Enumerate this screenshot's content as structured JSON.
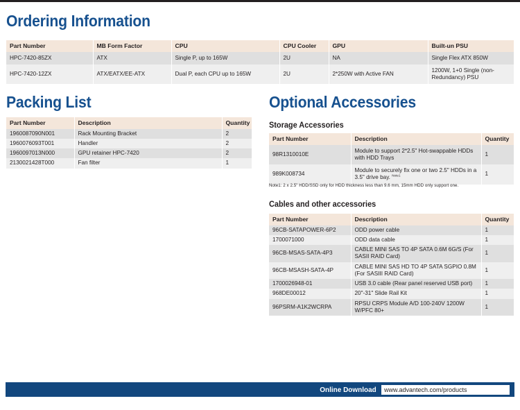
{
  "colors": {
    "heading_blue": "#17518f",
    "footer_blue": "#12477e",
    "table_header_beige": "#f4e6da",
    "row_dark": "#dfdfdf",
    "row_light": "#efefef"
  },
  "ordering": {
    "title": "Ordering Information",
    "columns": [
      "Part Number",
      "MB Form Factor",
      "CPU",
      "CPU Cooler",
      "GPU",
      "Built-un PSU"
    ],
    "rows": [
      {
        "part_number": "HPC-7420-85ZX",
        "mb_form_factor": "ATX",
        "cpu": "Single P, up to 165W",
        "cpu_cooler": "2U",
        "gpu": "NA",
        "psu": "Single Flex ATX 850W"
      },
      {
        "part_number": "HPC-7420-12ZX",
        "mb_form_factor": "ATX/EATX/EE-ATX",
        "cpu": "Dual P, each CPU up to 165W",
        "cpu_cooler": "2U",
        "gpu": "2*250W with Active FAN",
        "psu": "1200W, 1+0 Single (non-Redundancy) PSU"
      }
    ]
  },
  "packing": {
    "title": "Packing List",
    "columns": [
      "Part Number",
      "Description",
      "Quantity"
    ],
    "rows": [
      {
        "part_number": "1960087090N001",
        "description": "Rack Mounting Bracket",
        "quantity": "2"
      },
      {
        "part_number": "1960076093T001",
        "description": "Handler",
        "quantity": "2"
      },
      {
        "part_number": "1960097013N000",
        "description": "GPU retainer HPC-7420",
        "quantity": "2"
      },
      {
        "part_number": "2130021428T000",
        "description": "Fan filter",
        "quantity": "1"
      }
    ]
  },
  "optional": {
    "title": "Optional Accessories",
    "storage": {
      "subtitle": "Storage Accessories",
      "columns": [
        "Part Number",
        "Description",
        "Quantity"
      ],
      "rows": [
        {
          "part_number": "98R1310010E",
          "description": "Module to support 2*2.5\" Hot-swappable HDDs with HDD Trays",
          "note_ref": "",
          "quantity": "1"
        },
        {
          "part_number": "989K008734",
          "description": "Module to securely fix one or two 2.5\" HDDs in a 3.5\" drive bay.",
          "note_ref": "Note1",
          "quantity": "1"
        }
      ],
      "note": "Note1: 2 x 2.5\" HDD/SSD only for HDD thickness less than 9.6 mm, 15mm HDD only support one."
    },
    "cables": {
      "subtitle": "Cables and other accessories",
      "columns": [
        "Part Number",
        "Description",
        "Quantity"
      ],
      "rows": [
        {
          "part_number": "96CB-SATAPOWER-6P2",
          "description": "ODD power cable",
          "quantity": "1"
        },
        {
          "part_number": "1700071000",
          "description": "ODD data cable",
          "quantity": "1"
        },
        {
          "part_number": "96CB-MSAS-SATA-4P3",
          "description": "CABLE MINI SAS TO 4P SATA 0.6M 6G/S (For SASII RAID Card)",
          "quantity": "1"
        },
        {
          "part_number": "96CB-MSASH-SATA-4P",
          "description": "CABLE MINI SAS HD TO 4P SATA SGPIO 0.8M (For SASIII RAID Card)",
          "quantity": "1"
        },
        {
          "part_number": "1700026948-01",
          "description": "USB 3.0 cable (Rear panel reserved USB port)",
          "quantity": "1"
        },
        {
          "part_number": "968DE00012",
          "description": "20\"-31\" Slide Rail Kit",
          "quantity": "1"
        },
        {
          "part_number": "96PSRM-A1K2WCRPA",
          "description": "RPSU CRPS Module A/D 100-240V 1200W W/PFC 80+",
          "quantity": "1"
        }
      ]
    }
  },
  "footer": {
    "label": "Online Download",
    "url": "www.advantech.com/products"
  }
}
